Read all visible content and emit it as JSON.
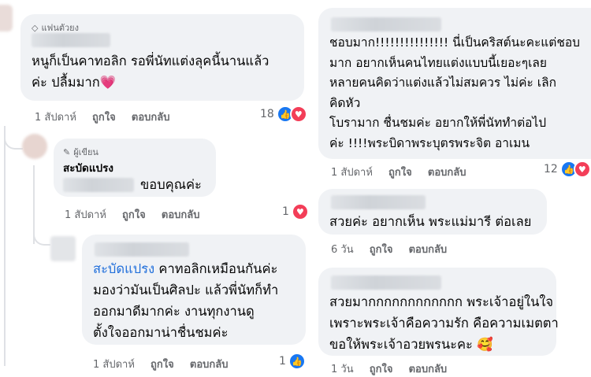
{
  "left": {
    "c1": {
      "badge": "แฟนตัวยง",
      "lines": [
        "หนูก็เป็นคาทอลิก รอพี่นัทแต่งลุคนี้นานแล้ว",
        "ค่ะ  ปลื้มมาก"
      ],
      "emoji": "💗",
      "time": "1 สัปดาห์",
      "like": "ถูกใจ",
      "reply": "ตอบกลับ",
      "count": "18"
    },
    "c2": {
      "badge": "ผู้เขียน",
      "author": "สะบัดแปรง",
      "text": "ขอบคุณค่ะ",
      "time": "1 สัปดาห์",
      "like": "ถูกใจ",
      "reply": "ตอบกลับ",
      "count": "1"
    },
    "c3": {
      "mention": "สะบัดแปรง",
      "line1_rest": " คาทอลิกเหมือนกันค่ะ",
      "lines": [
        "มองว่ามันเป็นศิลปะ แล้วพี่นัทก็ทำ",
        "ออกมาดีมากค่ะ งานทุกงานดู",
        "ตั้งใจออกมาน่าชื่นชมค่ะ"
      ],
      "time": "1 สัปดาห์",
      "like": "ถูกใจ",
      "reply": "ตอบกลับ",
      "count": "1"
    }
  },
  "right": {
    "c1": {
      "lines": [
        "ชอบมาก!!!!!!!!!!!!!!! นี่เป็นคริสต์นะคะแต่ชอบ",
        "มาก อยากเห็นคนไทยแต่งแบบนี้เยอะๆเลย",
        "หลายคนคิดว่าแต่งแล้วไม่สมควร ไม่ค่ะ เลิก",
        "คิดหัว",
        "โบรามาก ชื่นชมค่ะ อยากให้พี่นัททำต่อไป",
        "ค่ะ !!!!พระบิดาพระบุตรพระจิต อาเมน"
      ],
      "time": "1 สัปดาห์",
      "like": "ถูกใจ",
      "reply": "ตอบกลับ",
      "count": "12"
    },
    "c2": {
      "lines": [
        "สวยค่ะ อยากเห็น พระแม่มารี ต่อเลย"
      ],
      "time": "6 วัน",
      "like": "ถูกใจ",
      "reply": "ตอบกลับ"
    },
    "c3": {
      "lines": [
        "สวยมากกกกกกกกกกกก พระเจ้าอยู่ในใจ",
        "เพราะพระเจ้าคือความรัก คือความเมตตา",
        "ขอให้พระเจ้าอวยพรนะคะ"
      ],
      "emoji": "🥰",
      "time": "1 วัน",
      "like": "ถูกใจ",
      "reply": "ตอบกลับ"
    }
  },
  "icons": {
    "like": "👍",
    "love": "♥"
  },
  "colors": {
    "bubble": "#f0f2f5",
    "like": "#1877f2",
    "love": "#f33e58",
    "meta": "#65676b",
    "mention": "#216fdb"
  }
}
